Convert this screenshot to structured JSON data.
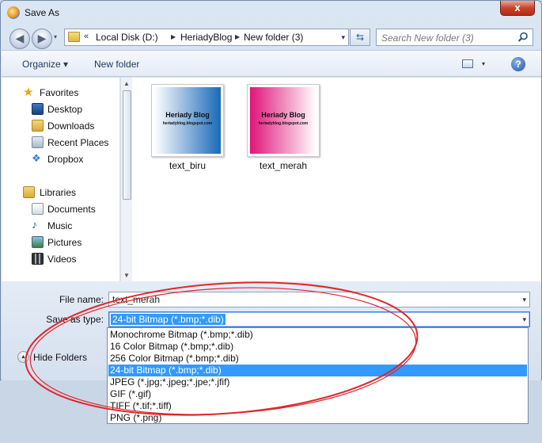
{
  "window": {
    "title": "Save As",
    "close_label": "x"
  },
  "navigation": {
    "back_glyph": "◀",
    "forward_glyph": "▶",
    "dropdown_glyph": "▾"
  },
  "address_bar": {
    "prefix": "«",
    "crumbs": [
      "Local Disk (D:)",
      "HeriadyBlog",
      "New folder (3)"
    ],
    "separator": "▶",
    "dropdown_glyph": "▾"
  },
  "search": {
    "placeholder": "Search New folder (3)"
  },
  "toolbar": {
    "organize_label": "Organize ▾",
    "new_folder_label": "New folder",
    "view_drop": "▾",
    "help_glyph": "?"
  },
  "sidebar": {
    "favorites_label": "Favorites",
    "favorites": [
      "Desktop",
      "Downloads",
      "Recent Places",
      "Dropbox"
    ],
    "libraries_label": "Libraries",
    "libraries": [
      "Documents",
      "Music",
      "Pictures",
      "Videos"
    ]
  },
  "files": [
    {
      "name": "text_biru",
      "title": "Heriady Blog",
      "subtitle": "heriadyblog.blogspot.com",
      "color": "#1a6ab8"
    },
    {
      "name": "text_merah",
      "title": "Heriady Blog",
      "subtitle": "heriadyblog.blogspot.com",
      "color": "#e0147a"
    }
  ],
  "form": {
    "file_name_label": "File name:",
    "file_name_value": "text_merah",
    "save_type_label": "Save as type:",
    "save_type_value": "24-bit Bitmap (*.bmp;*.dib)",
    "hide_folders_label": "Hide Folders"
  },
  "type_options": [
    "Monochrome Bitmap (*.bmp;*.dib)",
    "16 Color Bitmap (*.bmp;*.dib)",
    "256 Color Bitmap (*.bmp;*.dib)",
    "24-bit Bitmap (*.bmp;*.dib)",
    "JPEG (*.jpg;*.jpeg;*.jpe;*.jfif)",
    "GIF (*.gif)",
    "TIFF (*.tif;*.tiff)",
    "PNG (*.png)"
  ],
  "selected_option_index": 3,
  "colors": {
    "selection": "#3399ff",
    "annotation": "#e0262b"
  }
}
